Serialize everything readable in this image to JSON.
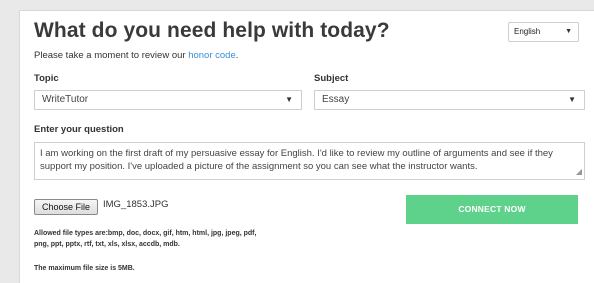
{
  "header": {
    "title": "What do you need help with today?",
    "language": "English"
  },
  "intro": {
    "text": "Please take a moment to review our ",
    "link": "honor code",
    "suffix": "."
  },
  "topic": {
    "label": "Topic",
    "value": "WriteTutor"
  },
  "subject": {
    "label": "Subject",
    "value": "Essay"
  },
  "question": {
    "label": "Enter your question",
    "value": "I am working on the first draft of my persuasive essay for English. I'd like to review my outline of arguments and see if they support my position. I've uploaded a picture of the assignment so you can see what the instructor wants."
  },
  "upload": {
    "button_label": "Choose File",
    "file_name": "IMG_1853.JPG",
    "allowed_line1": "Allowed file types are:bmp, doc, docx, gif, htm, html, jpg, jpeg, pdf,",
    "allowed_line2": "png, ppt, pptx, rtf, txt, xls, xlsx, accdb, mdb.",
    "max_size": "The maximum file size is 5MB."
  },
  "connect": {
    "label": "CONNECT NOW",
    "color": "#5ed18a"
  },
  "icons": {
    "dropdown": "chevron-down-icon",
    "resize": "resize-grip-icon"
  }
}
